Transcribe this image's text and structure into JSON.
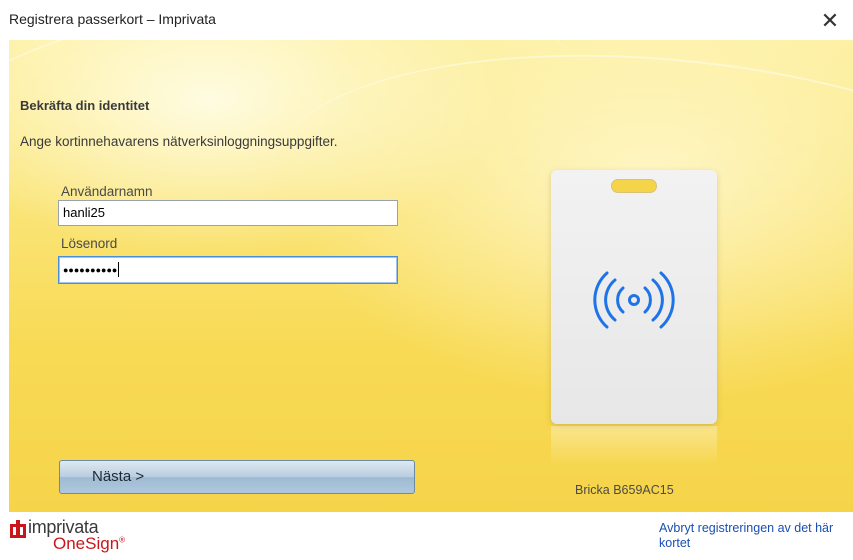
{
  "window": {
    "title": "Registrera passerkort – Imprivata",
    "close_glyph": "✕"
  },
  "form": {
    "heading": "Bekräfta din identitet",
    "instruction": "Ange kortinnehavarens nätverksinloggningsuppgifter.",
    "username_label": "Användarnamn",
    "username_value": "hanli25",
    "password_label": "Lösenord",
    "password_masked": "●●●●●●●●●●",
    "next_label": "Nästa >"
  },
  "card": {
    "icon": "nfc-contactless-icon",
    "badge_text": "Bricka B659AC15"
  },
  "footer": {
    "logo_name": "imprivata",
    "logo_product": "OneSign",
    "logo_mark": "®",
    "cancel_link": "Avbryt registreringen av det här kortet"
  },
  "colors": {
    "panel_yellow": "#f8da55",
    "link_blue": "#1a4fb5",
    "brand_red": "#c8161d",
    "nfc_blue": "#1e73e8"
  }
}
